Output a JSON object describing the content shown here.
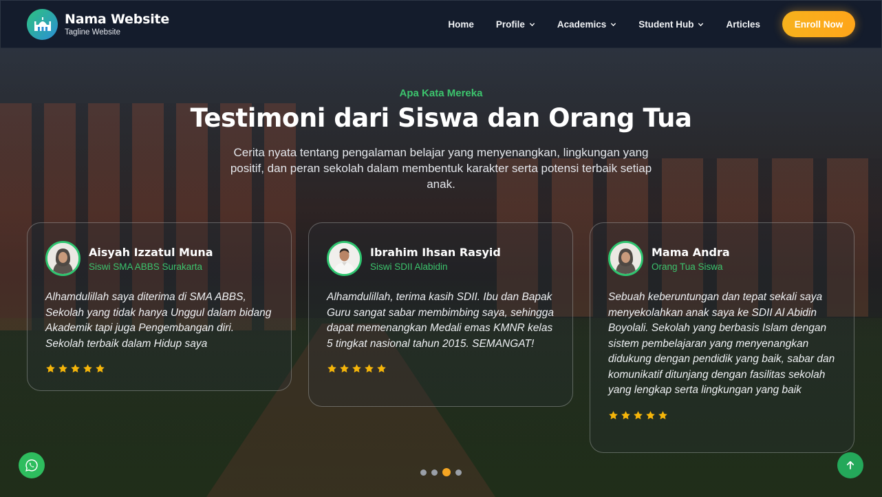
{
  "brand": {
    "title": "Nama Website",
    "tagline": "Tagline Website",
    "logo_icon": "mosque-icon"
  },
  "nav": {
    "items": [
      {
        "label": "Home",
        "has_dropdown": false
      },
      {
        "label": "Profile",
        "has_dropdown": true
      },
      {
        "label": "Academics",
        "has_dropdown": true
      },
      {
        "label": "Student Hub",
        "has_dropdown": true
      },
      {
        "label": "Articles",
        "has_dropdown": false
      }
    ],
    "cta_label": "Enroll Now"
  },
  "section": {
    "eyebrow": "Apa Kata Mereka",
    "title": "Testimoni dari Siswa dan Orang Tua",
    "description": "Cerita nyata tentang pengalaman belajar yang menyenangkan, lingkungan yang positif, dan peran sekolah dalam membentuk karakter serta potensi terbaik setiap anak."
  },
  "testimonials": [
    {
      "name": "Aisyah Izzatul Muna",
      "role": "Siswi SMA ABBS Surakarta",
      "quote": "Alhamdulillah saya diterima di SMA ABBS, Sekolah yang tidak hanya Unggul dalam bidang Akademik tapi juga Pengembangan diri. Sekolah terbaik dalam Hidup saya",
      "rating": 5
    },
    {
      "name": "Ibrahim Ihsan Rasyid",
      "role": "Siswi SDII Alabidin",
      "quote": "Alhamdulillah, terima kasih SDII. Ibu dan Bapak Guru sangat sabar membimbing saya, sehingga dapat memenangkan Medali emas KMNR kelas 5 tingkat nasional tahun 2015. SEMANGAT!",
      "rating": 5
    },
    {
      "name": "Mama Andra",
      "role": "Orang Tua Siswa",
      "quote": "Sebuah keberuntungan dan tepat sekali saya menyekolahkan anak saya ke SDII Al Abidin Boyolali. Sekolah yang berbasis Islam dengan sistem pembelajaran yang menyenangkan didukung dengan pendidik yang baik, sabar dan komunikatif ditunjang dengan fasilitas sekolah yang lengkap serta lingkungan yang baik",
      "rating": 5
    }
  ],
  "carousel": {
    "page_count": 4,
    "active_page": 3
  },
  "colors": {
    "accent_green": "#3cc46d",
    "cta_orange": "#f7b21d",
    "star_yellow": "#f5b50a",
    "navbar_bg": "#141c2c"
  },
  "floating": {
    "whatsapp_icon": "whatsapp-icon",
    "scroll_top_icon": "arrow-up-icon"
  }
}
